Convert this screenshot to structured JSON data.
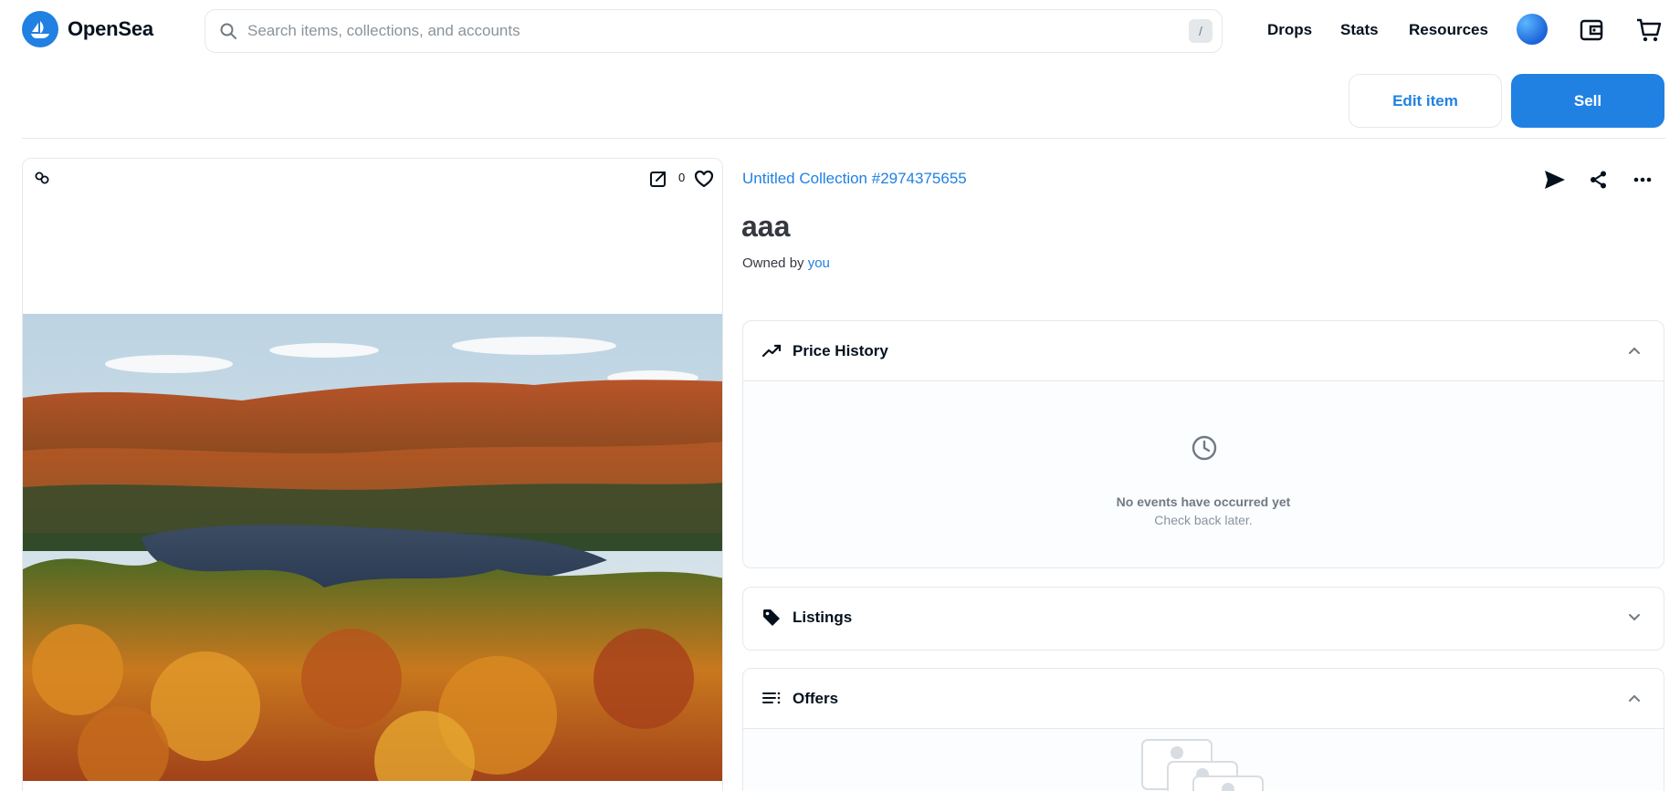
{
  "header": {
    "brand": "OpenSea",
    "search_placeholder": "Search items, collections, and accounts",
    "search_shortcut": "/",
    "nav": [
      "Drops",
      "Stats",
      "Resources"
    ]
  },
  "actions": {
    "edit_label": "Edit item",
    "sell_label": "Sell"
  },
  "media": {
    "favorites_count": "0"
  },
  "item": {
    "collection": "Untitled Collection #2974375655",
    "title": "aaa",
    "owned_prefix": "Owned by",
    "owner": "you"
  },
  "panels": {
    "price_history": {
      "title": "Price History",
      "empty_title": "No events have occurred yet",
      "empty_sub": "Check back later."
    },
    "listings": {
      "title": "Listings"
    },
    "offers": {
      "title": "Offers"
    }
  },
  "colors": {
    "accent": "#2081e2",
    "border": "#e5e8eb",
    "text_dark": "#04111d",
    "text_muted": "#707a83"
  }
}
